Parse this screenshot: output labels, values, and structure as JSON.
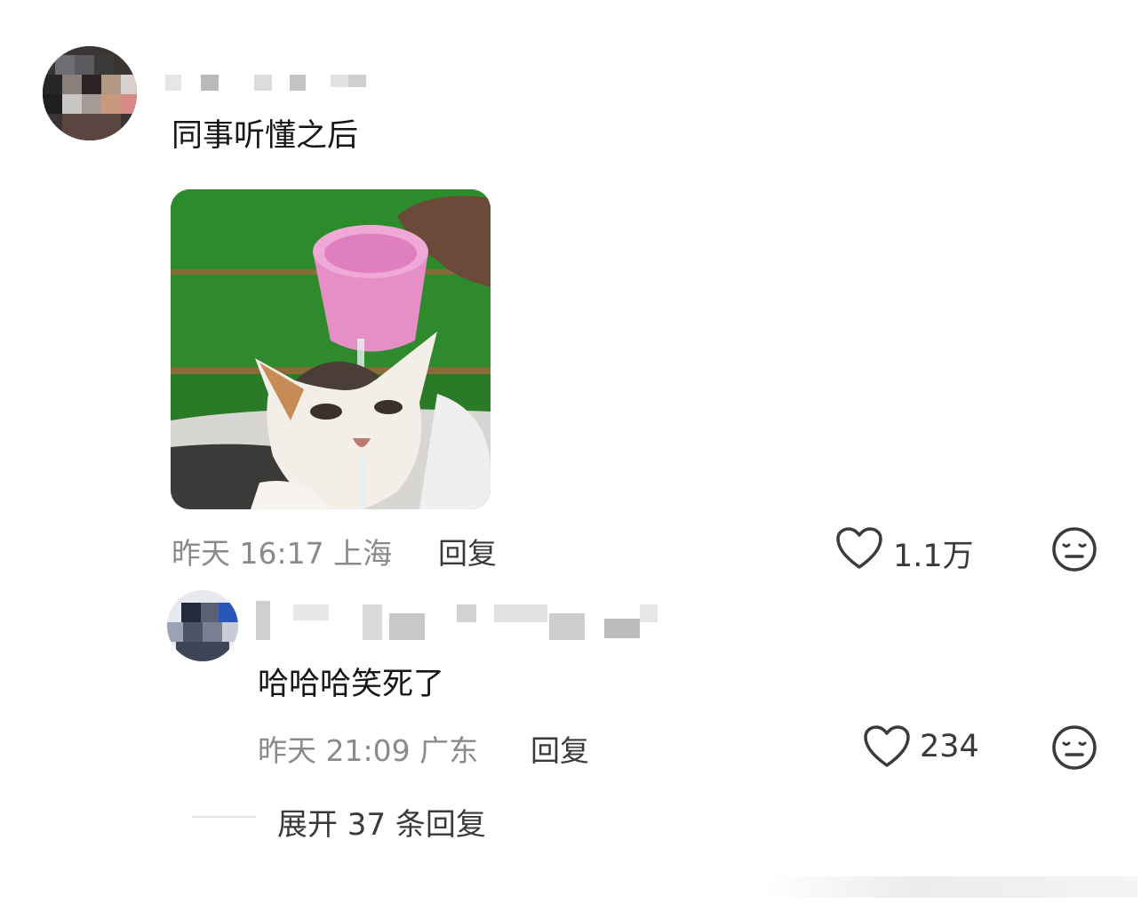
{
  "comments": [
    {
      "text": "同事听懂之后",
      "time_location": "昨天 16:17 上海",
      "reply_label": "回复",
      "likes": "1.1万",
      "image_icon": "cat-under-water-cup-image"
    },
    {
      "text": "哈哈哈笑死了",
      "time_location": "昨天 21:09 广东",
      "reply_label": "回复",
      "likes": "234"
    }
  ],
  "expand_replies_label": "展开 37 条回复",
  "icons": {
    "like": "heart-outline-icon",
    "dislike": "neutral-face-icon"
  }
}
